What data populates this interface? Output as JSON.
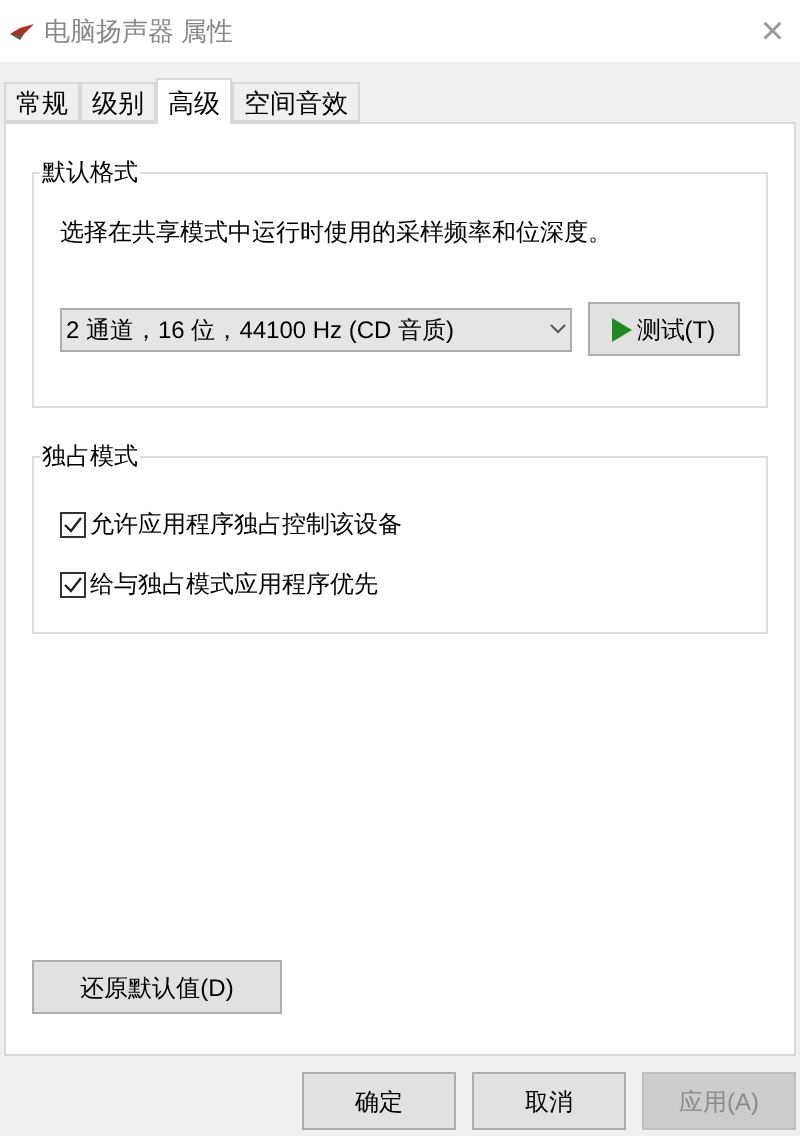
{
  "window": {
    "title": "电脑扬声器 属性",
    "close": "×"
  },
  "tabs": [
    {
      "label": "常规",
      "selected": false
    },
    {
      "label": "级别",
      "selected": false
    },
    {
      "label": "高级",
      "selected": true
    },
    {
      "label": "空间音效",
      "selected": false
    }
  ],
  "default_format": {
    "legend": "默认格式",
    "description": "选择在共享模式中运行时使用的采样频率和位深度。",
    "format_value": "2 通道，16 位，44100 Hz (CD 音质)",
    "test_button": "测试(T)"
  },
  "exclusive_mode": {
    "legend": "独占模式",
    "options": [
      {
        "label": "允许应用程序独占控制该设备",
        "checked": true
      },
      {
        "label": "给与独占模式应用程序优先",
        "checked": true
      }
    ]
  },
  "restore_button": "还原默认值(D)",
  "buttons": [
    {
      "label": "确定",
      "disabled": false
    },
    {
      "label": "取消",
      "disabled": false
    },
    {
      "label": "应用(A)",
      "disabled": true
    }
  ]
}
